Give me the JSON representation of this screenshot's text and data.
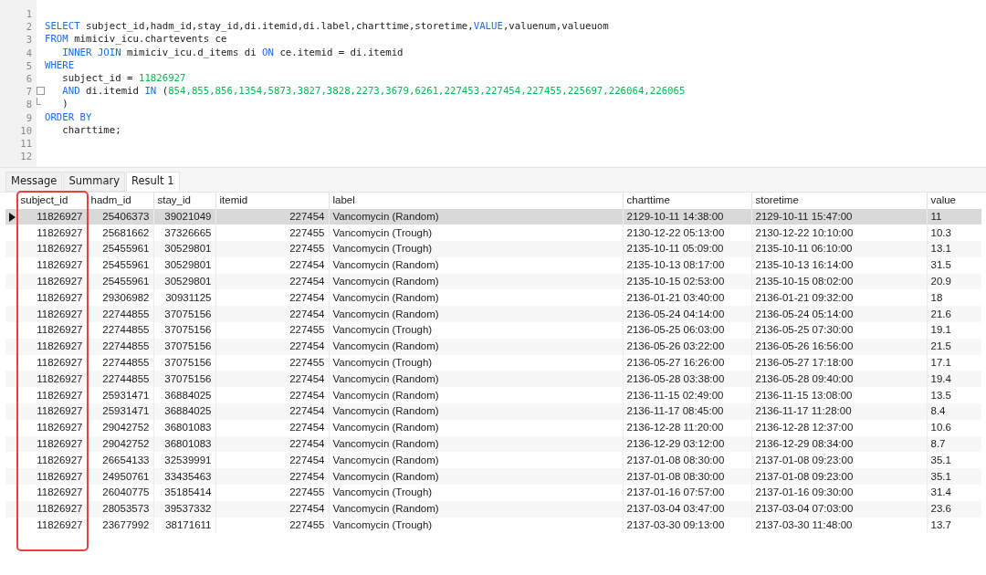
{
  "editor": {
    "lines": [
      {
        "number": "1"
      },
      {
        "number": "2",
        "tokens": [
          {
            "kind": "keyword",
            "text": "SELECT"
          },
          {
            "kind": "plain",
            "text": " subject_id,hadm_id,stay_id,di.itemid,di.label,charttime,storetime,"
          },
          {
            "kind": "keyword",
            "text": "VALUE"
          },
          {
            "kind": "plain",
            "text": ",valuenum,valueuom"
          }
        ]
      },
      {
        "number": "3",
        "tokens": [
          {
            "kind": "keyword",
            "text": "FROM"
          },
          {
            "kind": "plain",
            "text": " mimiciv_icu.chartevents ce"
          }
        ]
      },
      {
        "number": "4",
        "indented": true,
        "tokens": [
          {
            "kind": "keyword",
            "text": "INNER JOIN"
          },
          {
            "kind": "plain",
            "text": " mimiciv_icu.d_items di "
          },
          {
            "kind": "keyword",
            "text": "ON"
          },
          {
            "kind": "plain",
            "text": " ce.itemid = di.itemid"
          }
        ]
      },
      {
        "number": "5",
        "tokens": [
          {
            "kind": "keyword",
            "text": "WHERE"
          }
        ]
      },
      {
        "number": "6",
        "indented": true,
        "tokens": [
          {
            "kind": "plain",
            "text": "subject_id = "
          },
          {
            "kind": "number",
            "text": "11826927"
          }
        ]
      },
      {
        "number": "7",
        "indented": true,
        "fold_start": true,
        "tokens": [
          {
            "kind": "keyword",
            "text": "AND"
          },
          {
            "kind": "plain",
            "text": " di.itemid "
          },
          {
            "kind": "keyword",
            "text": "IN"
          },
          {
            "kind": "plain",
            "text": " ("
          },
          {
            "kind": "number",
            "text": "854,855,856,1354,5873,3827,3828,2273,3679,6261,227453,227454,227455,225697,226064,226065"
          }
        ]
      },
      {
        "number": "8",
        "indented": true,
        "fold_end": true,
        "tokens": [
          {
            "kind": "plain",
            "text": ")"
          }
        ]
      },
      {
        "number": "9",
        "tokens": [
          {
            "kind": "keyword",
            "text": "ORDER BY"
          }
        ]
      },
      {
        "number": "10",
        "indented": true,
        "tokens": [
          {
            "kind": "plain",
            "text": "charttime;"
          }
        ]
      },
      {
        "number": "11"
      },
      {
        "number": "12"
      }
    ]
  },
  "tabs": [
    {
      "label": "Message",
      "selected": false
    },
    {
      "label": "Summary",
      "selected": false
    },
    {
      "label": "Result 1",
      "selected": true
    }
  ],
  "table": {
    "columns": [
      {
        "label": "subject_id",
        "kind": "number",
        "highlighted": true
      },
      {
        "label": "hadm_id",
        "kind": "number"
      },
      {
        "label": "stay_id",
        "kind": "number"
      },
      {
        "label": "itemid",
        "kind": "number"
      },
      {
        "label": "label",
        "kind": "text"
      },
      {
        "label": "charttime",
        "kind": "text"
      },
      {
        "label": "storetime",
        "kind": "text"
      },
      {
        "label": "value",
        "kind": "text"
      }
    ],
    "rows": [
      {
        "selected": true,
        "cells": [
          "11826927",
          "25406373",
          "39021049",
          "227454",
          "Vancomycin (Random)",
          "2129-10-11 14:38:00",
          "2129-10-11 15:47:00",
          "11"
        ]
      },
      {
        "selected": false,
        "cells": [
          "11826927",
          "25681662",
          "37326665",
          "227455",
          "Vancomycin (Trough)",
          "2130-12-22 05:13:00",
          "2130-12-22 10:10:00",
          "10.3"
        ]
      },
      {
        "selected": false,
        "cells": [
          "11826927",
          "25455961",
          "30529801",
          "227455",
          "Vancomycin (Trough)",
          "2135-10-11 05:09:00",
          "2135-10-11 06:10:00",
          "13.1"
        ]
      },
      {
        "selected": false,
        "cells": [
          "11826927",
          "25455961",
          "30529801",
          "227454",
          "Vancomycin (Random)",
          "2135-10-13 08:17:00",
          "2135-10-13 16:14:00",
          "31.5"
        ]
      },
      {
        "selected": false,
        "cells": [
          "11826927",
          "25455961",
          "30529801",
          "227454",
          "Vancomycin (Random)",
          "2135-10-15 02:53:00",
          "2135-10-15 08:02:00",
          "20.9"
        ]
      },
      {
        "selected": false,
        "cells": [
          "11826927",
          "29306982",
          "30931125",
          "227454",
          "Vancomycin (Random)",
          "2136-01-21 03:40:00",
          "2136-01-21 09:32:00",
          "18"
        ]
      },
      {
        "selected": false,
        "cells": [
          "11826927",
          "22744855",
          "37075156",
          "227454",
          "Vancomycin (Random)",
          "2136-05-24 04:14:00",
          "2136-05-24 05:14:00",
          "21.6"
        ]
      },
      {
        "selected": false,
        "cells": [
          "11826927",
          "22744855",
          "37075156",
          "227455",
          "Vancomycin (Trough)",
          "2136-05-25 06:03:00",
          "2136-05-25 07:30:00",
          "19.1"
        ]
      },
      {
        "selected": false,
        "cells": [
          "11826927",
          "22744855",
          "37075156",
          "227454",
          "Vancomycin (Random)",
          "2136-05-26 03:22:00",
          "2136-05-26 16:56:00",
          "21.5"
        ]
      },
      {
        "selected": false,
        "cells": [
          "11826927",
          "22744855",
          "37075156",
          "227455",
          "Vancomycin (Trough)",
          "2136-05-27 16:26:00",
          "2136-05-27 17:18:00",
          "17.1"
        ]
      },
      {
        "selected": false,
        "cells": [
          "11826927",
          "22744855",
          "37075156",
          "227454",
          "Vancomycin (Random)",
          "2136-05-28 03:38:00",
          "2136-05-28 09:40:00",
          "19.4"
        ]
      },
      {
        "selected": false,
        "cells": [
          "11826927",
          "25931471",
          "36884025",
          "227454",
          "Vancomycin (Random)",
          "2136-11-15 02:49:00",
          "2136-11-15 13:08:00",
          "13.5"
        ]
      },
      {
        "selected": false,
        "cells": [
          "11826927",
          "25931471",
          "36884025",
          "227454",
          "Vancomycin (Random)",
          "2136-11-17 08:45:00",
          "2136-11-17 11:28:00",
          "8.4"
        ]
      },
      {
        "selected": false,
        "cells": [
          "11826927",
          "29042752",
          "36801083",
          "227454",
          "Vancomycin (Random)",
          "2136-12-28 11:20:00",
          "2136-12-28 12:37:00",
          "10.6"
        ]
      },
      {
        "selected": false,
        "cells": [
          "11826927",
          "29042752",
          "36801083",
          "227454",
          "Vancomycin (Random)",
          "2136-12-29 03:12:00",
          "2136-12-29 08:34:00",
          "8.7"
        ]
      },
      {
        "selected": false,
        "cells": [
          "11826927",
          "26654133",
          "32539991",
          "227454",
          "Vancomycin (Random)",
          "2137-01-08 08:30:00",
          "2137-01-08 09:23:00",
          "35.1"
        ]
      },
      {
        "selected": false,
        "cells": [
          "11826927",
          "24950761",
          "33435463",
          "227454",
          "Vancomycin (Random)",
          "2137-01-08 08:30:00",
          "2137-01-08 09:23:00",
          "35.1"
        ]
      },
      {
        "selected": false,
        "cells": [
          "11826927",
          "26040775",
          "35185414",
          "227455",
          "Vancomycin (Trough)",
          "2137-01-16 07:57:00",
          "2137-01-16 09:30:00",
          "31.4"
        ]
      },
      {
        "selected": false,
        "cells": [
          "11826927",
          "28053573",
          "39537332",
          "227454",
          "Vancomycin (Random)",
          "2137-03-04 03:47:00",
          "2137-03-04 07:03:00",
          "23.6"
        ]
      },
      {
        "selected": false,
        "cells": [
          "11826927",
          "23677992",
          "38171611",
          "227455",
          "Vancomycin (Trough)",
          "2137-03-30 09:13:00",
          "2137-03-30 11:48:00",
          "13.7"
        ]
      }
    ]
  }
}
